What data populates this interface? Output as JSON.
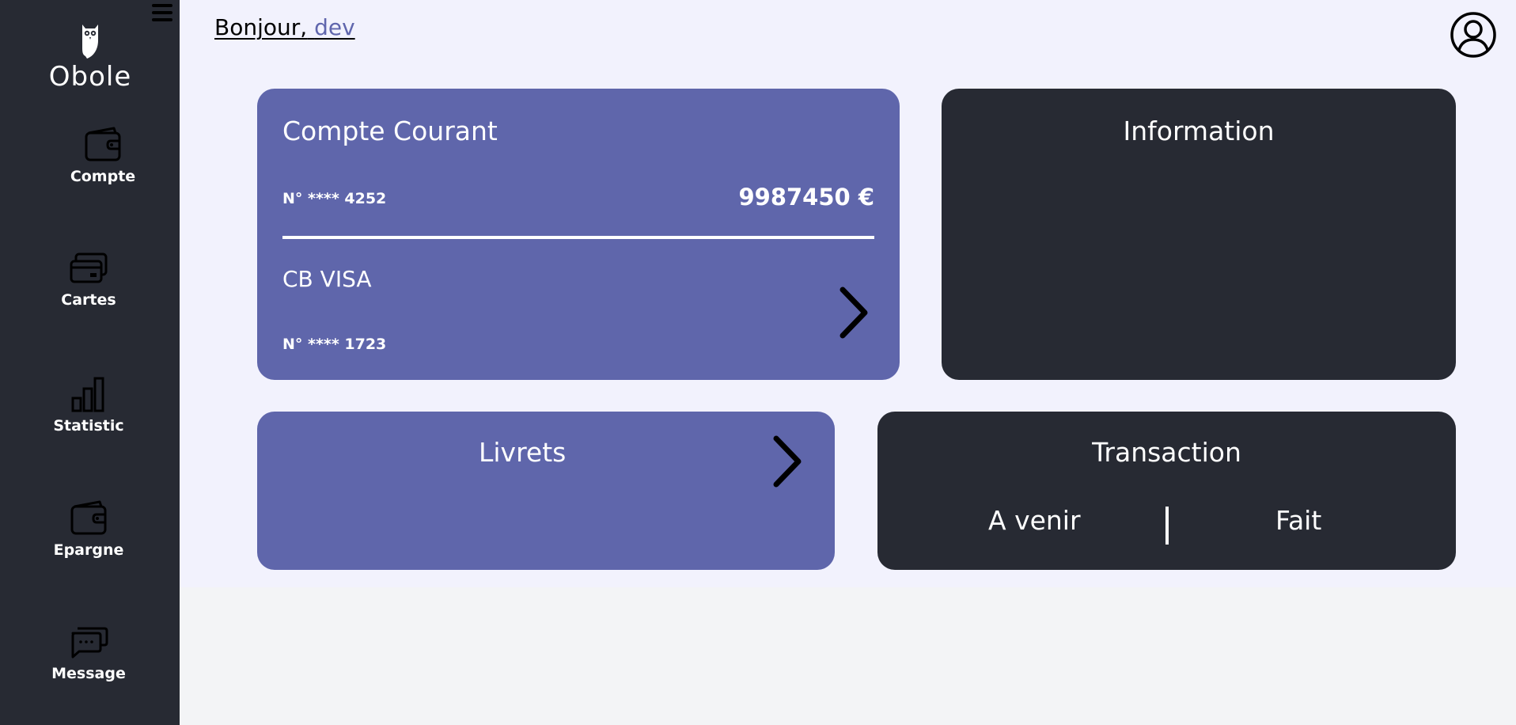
{
  "app": {
    "name": "Obole"
  },
  "sidebar": {
    "items": [
      {
        "label": "Compte",
        "icon": "wallet-icon"
      },
      {
        "label": "Cartes",
        "icon": "credit-cards-icon"
      },
      {
        "label": "Statistic",
        "icon": "bar-chart-icon"
      },
      {
        "label": "Epargne",
        "icon": "wallet-icon"
      },
      {
        "label": "Message",
        "icon": "chat-bubbles-icon"
      }
    ]
  },
  "header": {
    "greeting": "Bonjour,",
    "username": "dev"
  },
  "cards": {
    "compte": {
      "title": "Compte Courant",
      "account_number": "N° **** 4252",
      "balance": "9987450 €",
      "card_name": "CB VISA",
      "card_number": "N° **** 1723"
    },
    "info": {
      "title": "Information"
    },
    "livrets": {
      "title": "Livrets"
    },
    "transaction": {
      "title": "Transaction",
      "tabs": [
        "A venir",
        "Fait"
      ]
    }
  },
  "colors": {
    "sidebar": "#272a33",
    "card_purple": "#5f66ab",
    "card_dark": "#272a33",
    "main_bg": "#f2f2fd"
  }
}
